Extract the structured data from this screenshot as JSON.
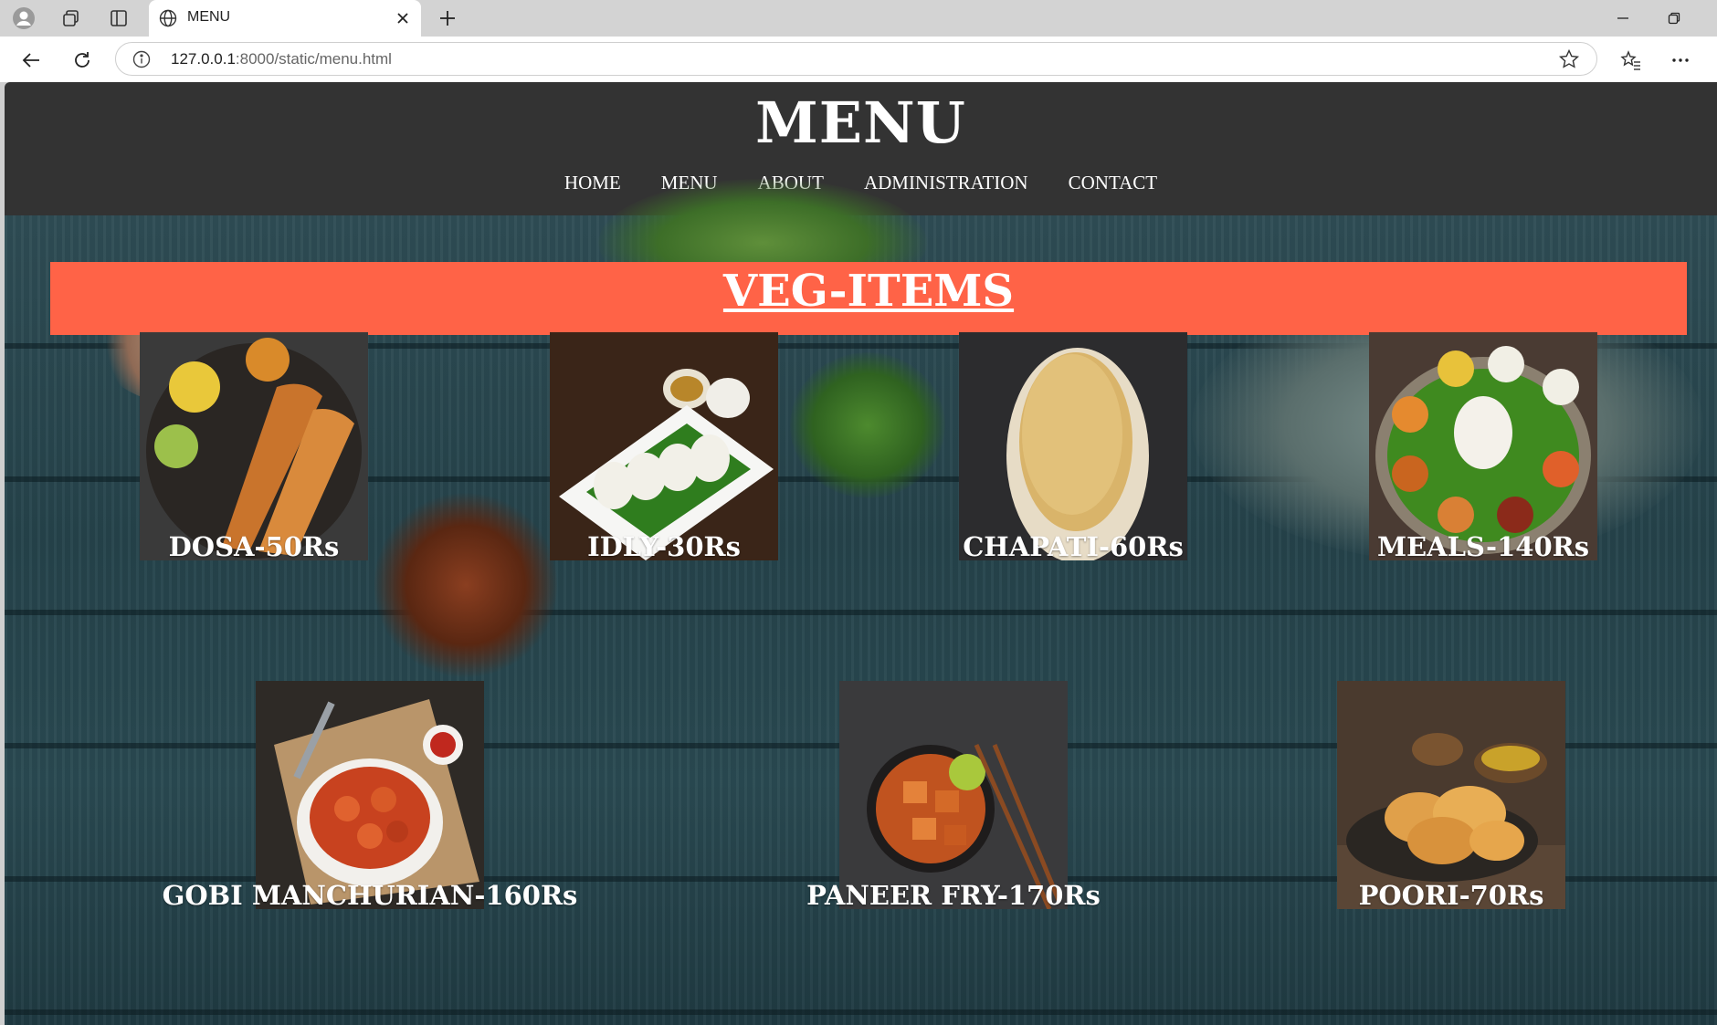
{
  "browser": {
    "tab_title": "MENU",
    "url_host": "127.0.0.1",
    "url_rest": ":8000/static/menu.html"
  },
  "site": {
    "title": "MENU",
    "nav": [
      "HOME",
      "MENU",
      "ABOUT",
      "ADMINISTRATION",
      "CONTACT"
    ]
  },
  "section": {
    "heading": "VEG-ITEMS"
  },
  "items": [
    {
      "label": "DOSA-50Rs",
      "icon": "dosa-image"
    },
    {
      "label": "IDLY-30Rs",
      "icon": "idly-image"
    },
    {
      "label": "CHAPATI-60Rs",
      "icon": "chapati-image"
    },
    {
      "label": "MEALS-140Rs",
      "icon": "meals-image"
    },
    {
      "label": "GOBI MANCHURIAN-160Rs",
      "icon": "gobi-manchurian-image"
    },
    {
      "label": "PANEER FRY-170Rs",
      "icon": "paneer-fry-image"
    },
    {
      "label": "POORI-70Rs",
      "icon": "poori-image"
    }
  ],
  "colors": {
    "header": "#333333",
    "banner": "#ff6347",
    "text": "#ffffff"
  }
}
